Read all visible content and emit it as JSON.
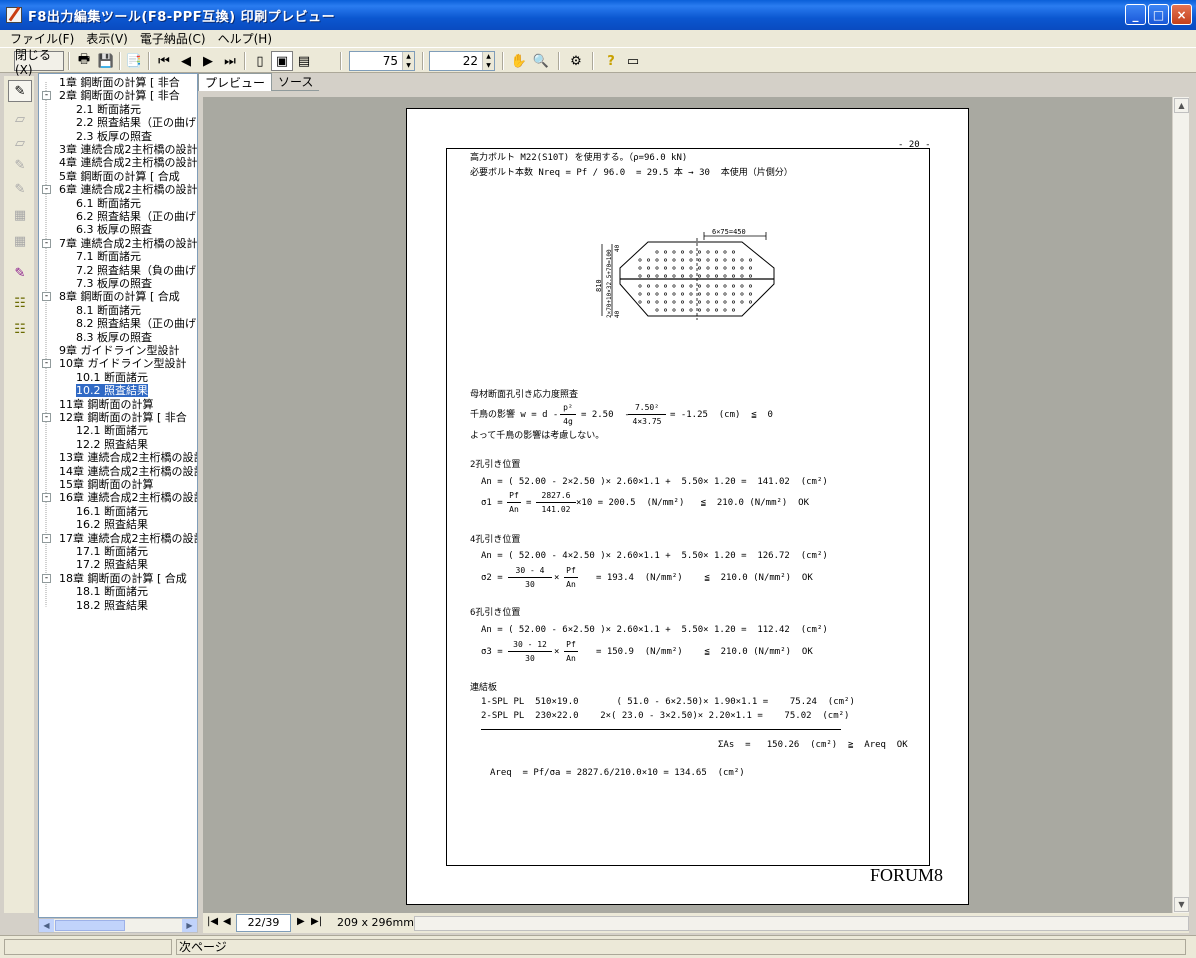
{
  "window": {
    "title": "F8出力編集ツール(F8-PPF互換) 印刷プレビュー",
    "minimize": "_",
    "maximize": "□",
    "close": "×"
  },
  "menu": [
    "ファイル(F)",
    "表示(V)",
    "電子納品(C)",
    "ヘルプ(H)"
  ],
  "toolbar": {
    "close_label": "閉じる(X)",
    "zoom_value": "75",
    "page_input_value": "22"
  },
  "tabs": {
    "preview": "プレビュー",
    "source": "ソース"
  },
  "tree": [
    {
      "text": "1章 鋼断面の計算 [ 非合",
      "level": 0,
      "exp": ""
    },
    {
      "text": "2章 鋼断面の計算 [ 非合",
      "level": 0,
      "exp": "-"
    },
    {
      "text": "2.1 断面諸元",
      "level": 1,
      "exp": ""
    },
    {
      "text": "2.2 照査結果（正の曲げ",
      "level": 1,
      "exp": ""
    },
    {
      "text": "2.3 板厚の照査",
      "level": 1,
      "exp": ""
    },
    {
      "text": "3章 連続合成2主桁橋の設計",
      "level": 0,
      "exp": ""
    },
    {
      "text": "4章 連続合成2主桁橋の設計",
      "level": 0,
      "exp": ""
    },
    {
      "text": "5章 鋼断面の計算 [ 合成",
      "level": 0,
      "exp": ""
    },
    {
      "text": "6章 連続合成2主桁橋の設計",
      "level": 0,
      "exp": "-"
    },
    {
      "text": "6.1 断面諸元",
      "level": 1,
      "exp": ""
    },
    {
      "text": "6.2 照査結果（正の曲げ",
      "level": 1,
      "exp": ""
    },
    {
      "text": "6.3 板厚の照査",
      "level": 1,
      "exp": ""
    },
    {
      "text": "7章 連続合成2主桁橋の設計",
      "level": 0,
      "exp": "-"
    },
    {
      "text": "7.1 断面諸元",
      "level": 1,
      "exp": ""
    },
    {
      "text": "7.2 照査結果（負の曲げ",
      "level": 1,
      "exp": ""
    },
    {
      "text": "7.3 板厚の照査",
      "level": 1,
      "exp": ""
    },
    {
      "text": "8章 鋼断面の計算 [ 合成",
      "level": 0,
      "exp": "-"
    },
    {
      "text": "8.1 断面諸元",
      "level": 1,
      "exp": ""
    },
    {
      "text": "8.2 照査結果（正の曲げ",
      "level": 1,
      "exp": ""
    },
    {
      "text": "8.3 板厚の照査",
      "level": 1,
      "exp": ""
    },
    {
      "text": "9章 ガイドライン型設計",
      "level": 0,
      "exp": ""
    },
    {
      "text": "10章 ガイドライン型設計",
      "level": 0,
      "exp": "-"
    },
    {
      "text": "10.1 断面諸元",
      "level": 1,
      "exp": ""
    },
    {
      "text": "10.2 照査結果",
      "level": 1,
      "exp": "",
      "selected": true
    },
    {
      "text": "11章 鋼断面の計算",
      "level": 0,
      "exp": ""
    },
    {
      "text": "12章 鋼断面の計算 [ 非合",
      "level": 0,
      "exp": "-"
    },
    {
      "text": "12.1 断面諸元",
      "level": 1,
      "exp": ""
    },
    {
      "text": "12.2 照査結果",
      "level": 1,
      "exp": ""
    },
    {
      "text": "13章 連続合成2主桁橋の設計",
      "level": 0,
      "exp": ""
    },
    {
      "text": "14章 連続合成2主桁橋の設計",
      "level": 0,
      "exp": ""
    },
    {
      "text": "15章 鋼断面の計算",
      "level": 0,
      "exp": ""
    },
    {
      "text": "16章 連続合成2主桁橋の設計",
      "level": 0,
      "exp": "-"
    },
    {
      "text": "16.1 断面諸元",
      "level": 1,
      "exp": ""
    },
    {
      "text": "16.2 照査結果",
      "level": 1,
      "exp": ""
    },
    {
      "text": "17章 連続合成2主桁橋の設計",
      "level": 0,
      "exp": "-"
    },
    {
      "text": "17.1 断面諸元",
      "level": 1,
      "exp": ""
    },
    {
      "text": "17.2 照査結果",
      "level": 1,
      "exp": ""
    },
    {
      "text": "18章 鋼断面の計算 [ 合成",
      "level": 0,
      "exp": "-"
    },
    {
      "text": "18.1 断面諸元",
      "level": 1,
      "exp": ""
    },
    {
      "text": "18.2 照査結果",
      "level": 1,
      "exp": ""
    }
  ],
  "document": {
    "page_number": "- 20 -",
    "footer_logo": "FORUM8",
    "line1": "高力ボルト M22(S10T) を使用する。（ρ=96.0 kN)",
    "line2": "必要ボルト本数 Nreq = Pf / 96.0  = 29.5 本 → 30  本使用（片側分）",
    "fig_top_dim": "6×75=450",
    "fig_left_dim_a": "810",
    "fig_left_dim_b": "2×70+10×32.5+70=100",
    "fig_left_dim_c": "40",
    "fig_left_dim_d": "40",
    "sec1_title": "母材断面孔引き応力度照査",
    "sec1_l1a": "千鳥の影響 w = d -",
    "sec1_l1_num1": "p²",
    "sec1_l1_den1": "4g",
    "sec1_l1b": "= 2.50  -",
    "sec1_l1_num2": "7.50²",
    "sec1_l1_den2": "4×3.75",
    "sec1_l1c": "= -1.25  (cm)  ≦  0",
    "sec1_l2": "よって千鳥の影響は考慮しない。",
    "sec2_title": "2孔引き位置",
    "sec2_l1": "An = ( 52.00 - 2×2.50 )× 2.60×1.1 +  5.50× 1.20 =  141.02  (cm²)",
    "sec2_l2a": "σ1 =",
    "sec2_l2_num1": "Pf",
    "sec2_l2_den1": "An",
    "sec2_l2_eq": "=",
    "sec2_l2_num2": "2827.6",
    "sec2_l2_den2": "141.02",
    "sec2_l2b": "×10 = 200.5  (N/mm²)   ≦  210.0 (N/mm²)  OK",
    "sec3_title": "4孔引き位置",
    "sec3_l1": "An = ( 52.00 - 4×2.50 )× 2.60×1.1 +  5.50× 1.20 =  126.72  (cm²)",
    "sec3_l2a": "σ2 =",
    "sec3_l2_num1": "30 -  4",
    "sec3_l2_den1": "30",
    "sec3_l2_mul": "×",
    "sec3_l2_num2": "Pf",
    "sec3_l2_den2": "An",
    "sec3_l2b": "= 193.4  (N/mm²)    ≦  210.0 (N/mm²)  OK",
    "sec4_title": "6孔引き位置",
    "sec4_l1": "An = ( 52.00 - 6×2.50 )× 2.60×1.1 +  5.50× 1.20 =  112.42  (cm²)",
    "sec4_l2a": "σ3 =",
    "sec4_l2_num1": "30 -  12",
    "sec4_l2_den1": "30",
    "sec4_l2_mul": "×",
    "sec4_l2_num2": "Pf",
    "sec4_l2_den2": "An",
    "sec4_l2b": "= 150.9  (N/mm²)    ≦  210.0 (N/mm²)  OK",
    "sec5_title": "連結板",
    "sec5_l1": "1-SPL PL  510×19.0       ( 51.0 - 6×2.50)× 1.90×1.1 =    75.24  (cm²)",
    "sec5_l2": "2-SPL PL  230×22.0    2×( 23.0 - 3×2.50)× 2.20×1.1 =    75.02  (cm²)",
    "sec5_sum": "ΣAs  =   150.26  (cm²)  ≧  Areq  OK",
    "areq": "Areq  = Pf/σa = 2827.6/210.0×10 = 134.65  (cm²)"
  },
  "navigation": {
    "page_indicator": "22/39",
    "paper_size": "209 x 296mm"
  },
  "status": {
    "message": "次ページ"
  }
}
